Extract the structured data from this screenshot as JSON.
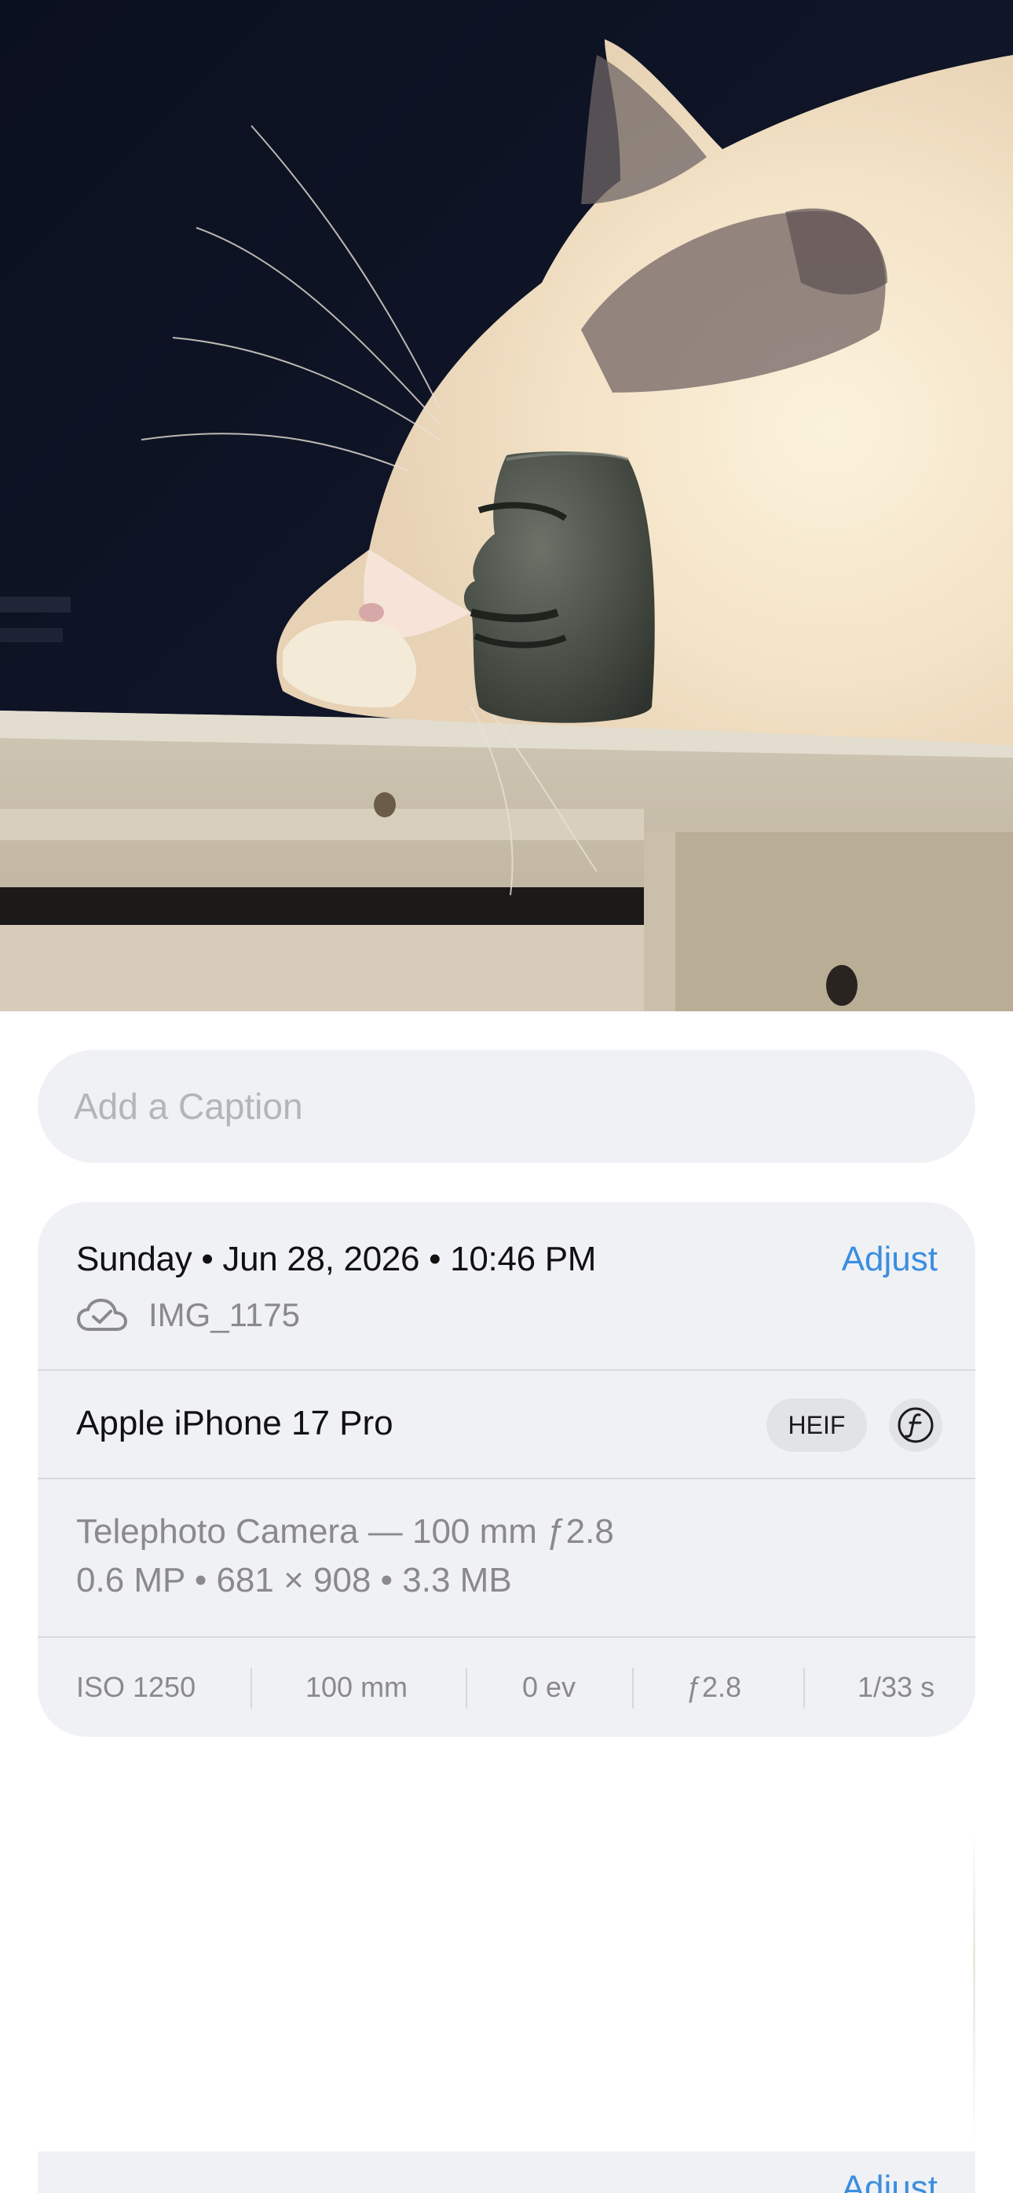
{
  "photo": {
    "description_icon": "photo-image"
  },
  "caption": {
    "placeholder": "Add a Caption",
    "value": ""
  },
  "info": {
    "datetime": "Sunday • Jun 28, 2026 • 10:46 PM",
    "adjust_label": "Adjust",
    "file_icon": "cloud-check-icon",
    "file_name": "IMG_1175",
    "device_name": "Apple iPhone 17 Pro",
    "format_badge": "HEIF",
    "aperture_icon": "aperture-f-icon",
    "camera_lens": "Telephoto Camera — 100 mm ƒ2.8",
    "image_specs": "0.6 MP • 681 × 908 • 3.3 MB",
    "exif": {
      "iso": "ISO 1250",
      "focal": "100 mm",
      "ev": "0 ev",
      "aperture": "ƒ2.8",
      "shutter": "1/33 s"
    }
  },
  "lower": {
    "adjust_label": "Adjust"
  },
  "colors": {
    "accent": "#3a8ee0",
    "card_bg": "#f0f1f5",
    "secondary_text": "#8a8a8e",
    "primary_text": "#111111"
  }
}
